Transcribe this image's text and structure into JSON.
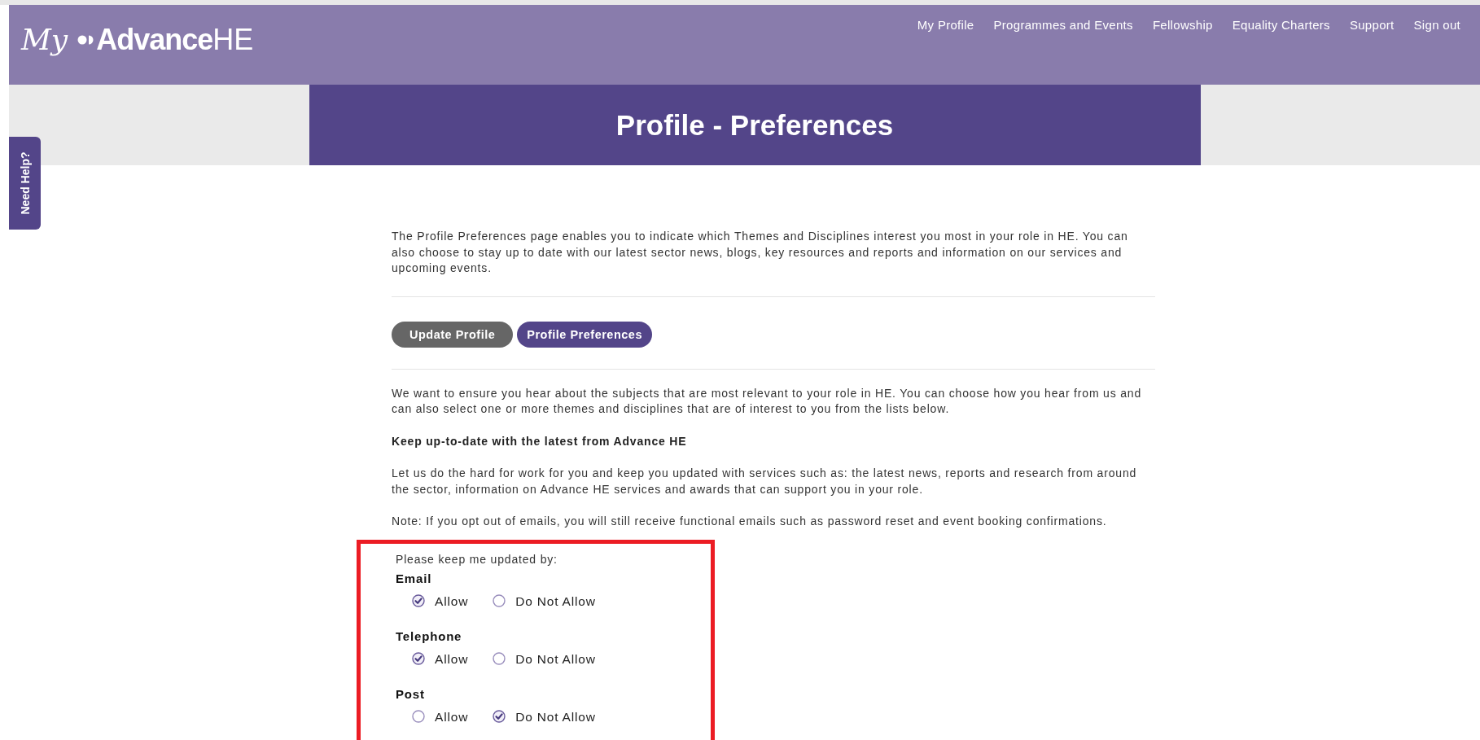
{
  "header": {
    "logo": {
      "my": "My",
      "brand": "Advance",
      "suffix": "HE"
    },
    "nav": [
      "My Profile",
      "Programmes and Events",
      "Fellowship",
      "Equality Charters",
      "Support",
      "Sign out"
    ]
  },
  "help_tab": "Need Help?",
  "page_title": "Profile - Preferences",
  "intro": "The Profile Preferences page enables you to indicate which Themes and Disciplines interest you most in your role in HE. You can also choose to stay up to date with our latest sector news, blogs, key resources and reports and information on our services and upcoming events.",
  "tabs": [
    {
      "label": "Update Profile",
      "selected": false
    },
    {
      "label": "Profile Preferences",
      "selected": true
    }
  ],
  "description": "We want to ensure you hear about the subjects that are most relevant to your role in HE. You can choose how you hear from us and can also select one or more themes and disciplines that are of interest to you from the lists below.",
  "section_heading": "Keep up-to-date with the latest from Advance HE",
  "section_text": "Let us do the hard for work for you and keep you updated with services such as: the latest news, reports and research from around the sector, information on Advance HE services and awards that can support you in your role.",
  "note": "Note: If you opt out of emails, you will still receive functional emails such as password reset and event booking confirmations.",
  "preferences": {
    "prompt": "Please keep me updated by:",
    "channels": [
      {
        "name": "Email",
        "options": [
          {
            "label": "Allow",
            "selected": true
          },
          {
            "label": "Do Not Allow",
            "selected": false
          }
        ]
      },
      {
        "name": "Telephone",
        "options": [
          {
            "label": "Allow",
            "selected": true
          },
          {
            "label": "Do Not Allow",
            "selected": false
          }
        ]
      },
      {
        "name": "Post",
        "options": [
          {
            "label": "Allow",
            "selected": false
          },
          {
            "label": "Do Not Allow",
            "selected": true
          }
        ]
      }
    ]
  }
}
